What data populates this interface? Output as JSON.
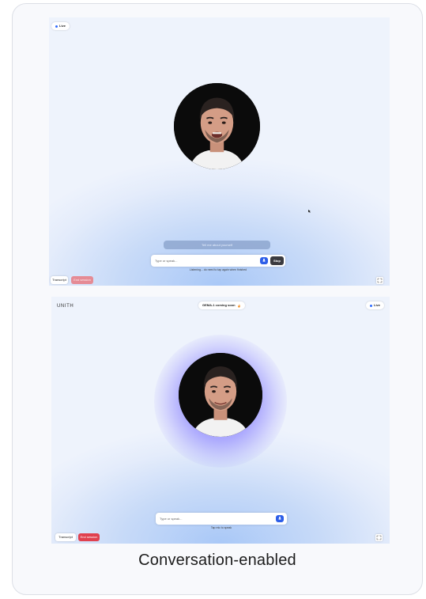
{
  "caption": "Conversation-enabled",
  "panel1": {
    "live_label": "Live",
    "suggestion": "Tell me about yourself",
    "input_placeholder": "Type or speak...",
    "mic_icon": "mic-icon",
    "stop_label": "Stop",
    "hint": "Listening... do need to tap again when finished",
    "transcript_label": "Transcript",
    "end_session_label": "End session"
  },
  "panel2": {
    "logo": "UNITH",
    "announcement": "GEMA-1 coming soon",
    "announcement_icon": "fire-icon",
    "live_label": "Live",
    "input_placeholder": "Type or speak...",
    "hint": "Tap mic to speak",
    "transcript_label": "Transcript",
    "end_session_label": "End session"
  },
  "colors": {
    "accent": "#2d5ee8",
    "end_session": "#e0414f",
    "live_dot": "#2f6bff"
  }
}
